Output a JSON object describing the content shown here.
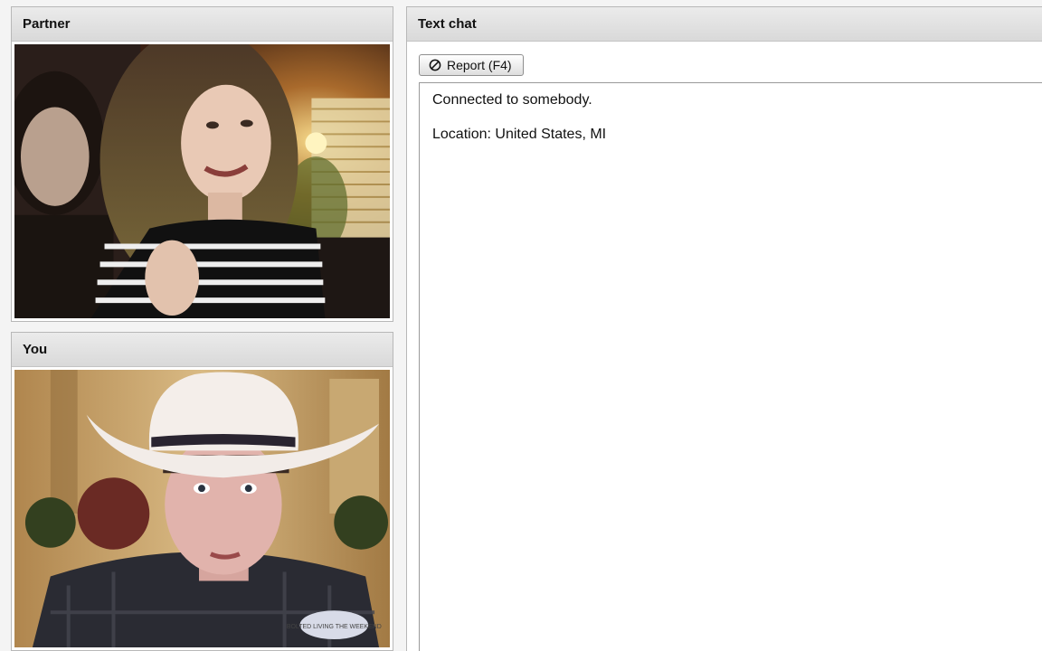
{
  "partner": {
    "title": "Partner"
  },
  "you": {
    "title": "You",
    "shirt_patch": "BOLTED LIVING THE WEEKEND"
  },
  "chat": {
    "title": "Text chat",
    "report_label": "Report (F4)",
    "messages": [
      "Connected to somebody.",
      "Location: United States, MI"
    ]
  },
  "colors": {
    "header_bg": "#e2e2e2",
    "panel_border": "#b8b8b8"
  },
  "icons": {
    "report": "prohibited-icon"
  }
}
